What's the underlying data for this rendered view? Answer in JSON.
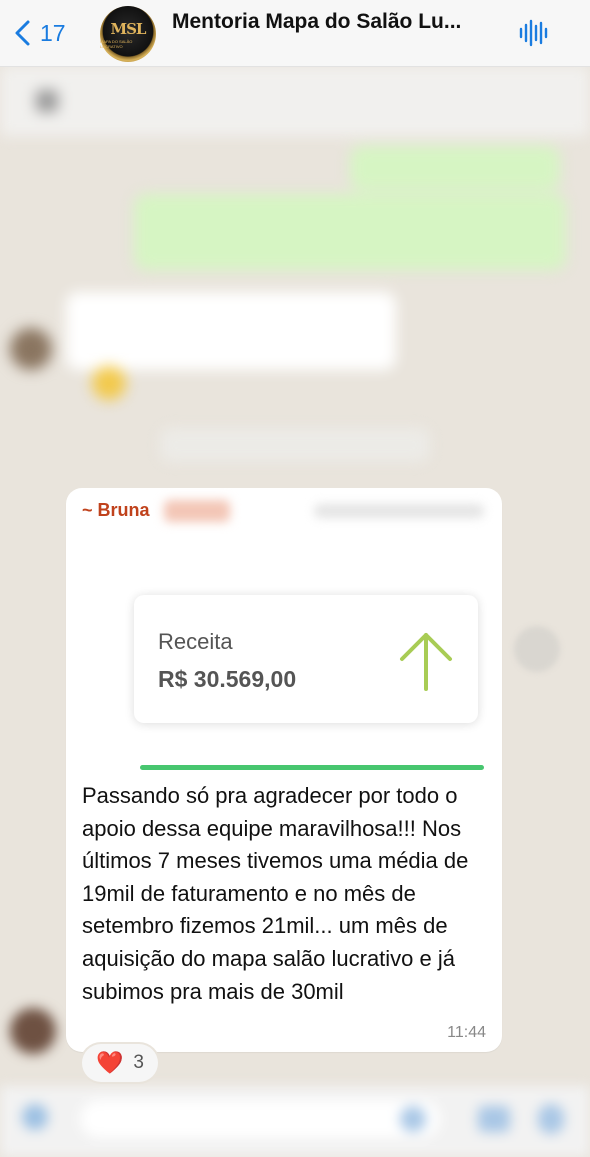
{
  "header": {
    "back_count": "17",
    "group_name": "Mentoria Mapa do Salão Lu...",
    "avatar_text": "MSL",
    "avatar_subtext": "MAPA DO SALÃO LUCRATIVO",
    "accent": "#1a7ce0"
  },
  "message": {
    "sender": "~ Bruna",
    "sender_color": "#c0421c",
    "card": {
      "label": "Receita",
      "value": "R$ 30.569,00",
      "arrow_icon": "arrow-up-icon",
      "arrow_color": "#a8cc55"
    },
    "text": "Passando só pra agradecer por todo o apoio dessa equipe maravilhosa!!! Nos últimos 7 meses tivemos uma média de 19mil de faturamento e no mês de setembro fizemos 21mil... um mês de aquisição do mapa salão lucrativo e já subimos pra mais de 30mil",
    "time": "11:44",
    "reaction": {
      "emoji": "❤️",
      "count": "3"
    }
  }
}
